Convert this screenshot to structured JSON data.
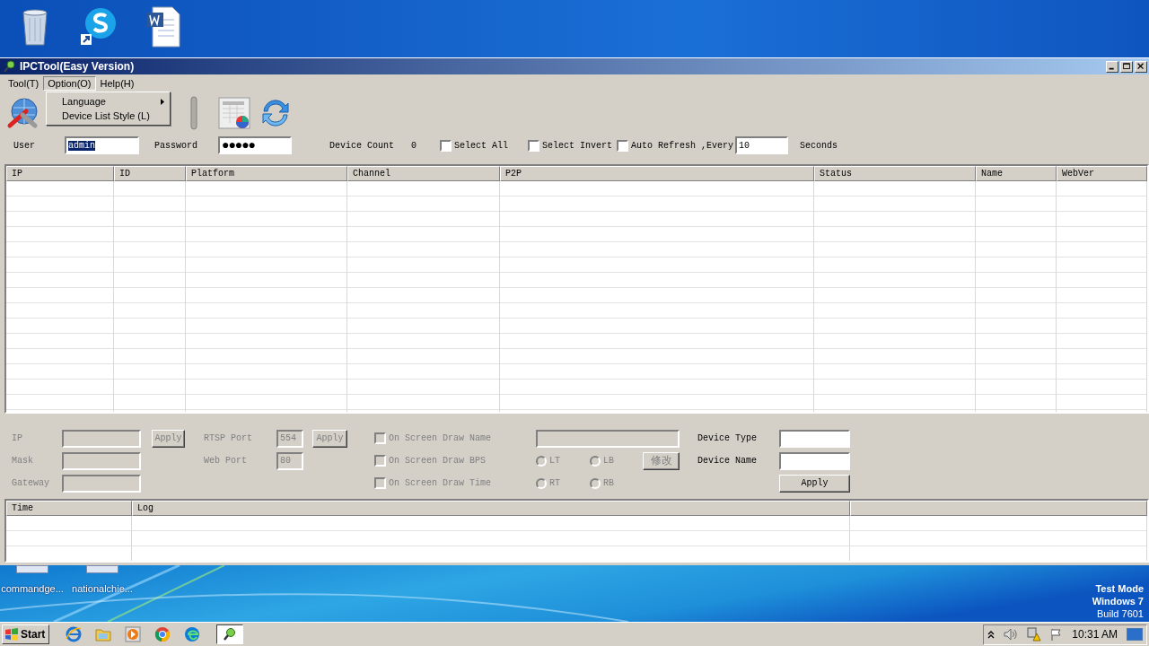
{
  "desktop": {
    "bottom_icons": [
      {
        "label": "commandge..."
      },
      {
        "label": "nationalchie..."
      }
    ],
    "watermark": [
      "Test Mode",
      "Windows 7",
      "Build 7601"
    ]
  },
  "window": {
    "title": "IPCTool(Easy Version)",
    "menu": [
      {
        "label": "Tool(T)",
        "selected": false
      },
      {
        "label": "Option(O)",
        "selected": true
      },
      {
        "label": "Help(H)",
        "selected": false
      }
    ],
    "dropdown": [
      {
        "label": "Language",
        "submenu": true
      },
      {
        "label": "Device List Style (L)",
        "submenu": false
      }
    ],
    "login": {
      "user_label": "User",
      "user": {
        "value": "admin",
        "selected": true
      },
      "password_label": "Password",
      "password": "●●●●●",
      "device_count_label": "Device Count",
      "device_count": "0",
      "select_all": {
        "label": "Select All",
        "checked": false
      },
      "select_invert": {
        "label": "Select Invert",
        "checked": false
      },
      "auto_refresh": {
        "label": "Auto Refresh ,Every",
        "checked": false
      },
      "interval": "10",
      "seconds_label": "Seconds"
    },
    "device_table": {
      "columns": [
        "IP",
        "ID",
        "Platform",
        "Channel",
        "P2P",
        "Status",
        "Name",
        "WebVer"
      ]
    },
    "settings": {
      "ip_fields": [
        {
          "label": "IP",
          "disabled": true
        },
        {
          "label": "Mask",
          "disabled": true
        },
        {
          "label": "Gateway",
          "disabled": true
        }
      ],
      "ip_apply": {
        "label": "Apply",
        "disabled": true
      },
      "port_fields": [
        {
          "label": "RTSP Port",
          "value": "554",
          "disabled": true
        },
        {
          "label": "Web Port",
          "value": "80",
          "disabled": true
        }
      ],
      "port_apply": {
        "label": "Apply",
        "disabled": true
      },
      "osd_options": [
        {
          "label": "On Screen Draw Name",
          "checked": false,
          "disabled": true
        },
        {
          "label": "On Screen Draw BPS",
          "checked": false,
          "disabled": true
        },
        {
          "label": "On Screen Draw Time",
          "checked": false,
          "disabled": true
        }
      ],
      "osd_text": {
        "disabled": true
      },
      "positions": [
        {
          "label": "LT",
          "selected": false,
          "disabled": true
        },
        {
          "label": "LB",
          "selected": false,
          "disabled": true
        },
        {
          "label": "RT",
          "selected": false,
          "disabled": true
        },
        {
          "label": "RB",
          "selected": false,
          "disabled": true
        }
      ],
      "modify_button": {
        "label": "修改",
        "disabled": true
      },
      "device_fields": [
        {
          "label": "Device Type",
          "disabled": false
        },
        {
          "label": "Device Name",
          "disabled": false
        }
      ],
      "device_apply": {
        "label": "Apply",
        "disabled": false
      }
    },
    "log_table": {
      "columns": [
        "Time",
        "Log"
      ]
    }
  },
  "taskbar": {
    "start": "Start",
    "clock": "10:31 AM"
  }
}
